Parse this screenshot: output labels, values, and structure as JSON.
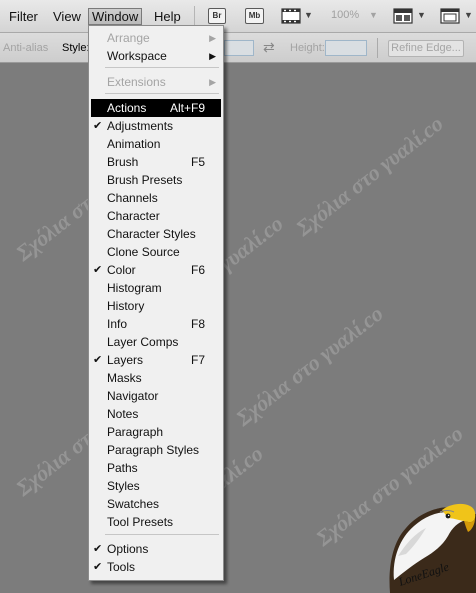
{
  "menubar": {
    "items": [
      {
        "label": "Filter"
      },
      {
        "label": "View"
      },
      {
        "label": "Window"
      },
      {
        "label": "Help"
      }
    ],
    "bridge_label": "Br",
    "minibridge_label": "Mb",
    "zoom": "100%",
    "view_extras_icon": "film-strip-icon",
    "arrange_icon": "arrange-documents-icon",
    "screen_mode_icon": "screen-mode-icon"
  },
  "options_bar": {
    "anti_alias": "Anti-alias",
    "style_label": "Style:",
    "height_label": "Height:",
    "swap_icon": "swap-icon",
    "refine_edge": "Refine Edge..."
  },
  "watermark": {
    "text": "Σχόλια στο γυαλί.co"
  },
  "window_menu": {
    "items": [
      {
        "label": "Arrange",
        "disabled": true,
        "submenu": true,
        "checked": false,
        "shortcut": ""
      },
      {
        "label": "Workspace",
        "disabled": false,
        "submenu": true,
        "checked": false,
        "shortcut": ""
      },
      {
        "label": "Extensions",
        "disabled": true,
        "submenu": true,
        "checked": false,
        "shortcut": ""
      },
      {
        "label": "Actions",
        "disabled": false,
        "submenu": false,
        "checked": false,
        "shortcut": "Alt+F9",
        "highlighted": true
      },
      {
        "label": "Adjustments",
        "checked": true,
        "shortcut": ""
      },
      {
        "label": "Animation",
        "checked": false,
        "shortcut": ""
      },
      {
        "label": "Brush",
        "checked": false,
        "shortcut": "F5"
      },
      {
        "label": "Brush Presets",
        "checked": false,
        "shortcut": ""
      },
      {
        "label": "Channels",
        "checked": false,
        "shortcut": ""
      },
      {
        "label": "Character",
        "checked": false,
        "shortcut": ""
      },
      {
        "label": "Character Styles",
        "checked": false,
        "shortcut": ""
      },
      {
        "label": "Clone Source",
        "checked": false,
        "shortcut": ""
      },
      {
        "label": "Color",
        "checked": true,
        "shortcut": "F6"
      },
      {
        "label": "Histogram",
        "checked": false,
        "shortcut": ""
      },
      {
        "label": "History",
        "checked": false,
        "shortcut": ""
      },
      {
        "label": "Info",
        "checked": false,
        "shortcut": "F8"
      },
      {
        "label": "Layer Comps",
        "checked": false,
        "shortcut": ""
      },
      {
        "label": "Layers",
        "checked": true,
        "shortcut": "F7"
      },
      {
        "label": "Masks",
        "checked": false,
        "shortcut": ""
      },
      {
        "label": "Navigator",
        "checked": false,
        "shortcut": ""
      },
      {
        "label": "Notes",
        "checked": false,
        "shortcut": ""
      },
      {
        "label": "Paragraph",
        "checked": false,
        "shortcut": ""
      },
      {
        "label": "Paragraph Styles",
        "checked": false,
        "shortcut": ""
      },
      {
        "label": "Paths",
        "checked": false,
        "shortcut": ""
      },
      {
        "label": "Styles",
        "checked": false,
        "shortcut": ""
      },
      {
        "label": "Swatches",
        "checked": false,
        "shortcut": ""
      },
      {
        "label": "Tool Presets",
        "checked": false,
        "shortcut": ""
      },
      {
        "label": "Options",
        "checked": true,
        "shortcut": ""
      },
      {
        "label": "Tools",
        "checked": true,
        "shortcut": ""
      }
    ]
  },
  "logo": {
    "signature": "LoneEagle"
  }
}
